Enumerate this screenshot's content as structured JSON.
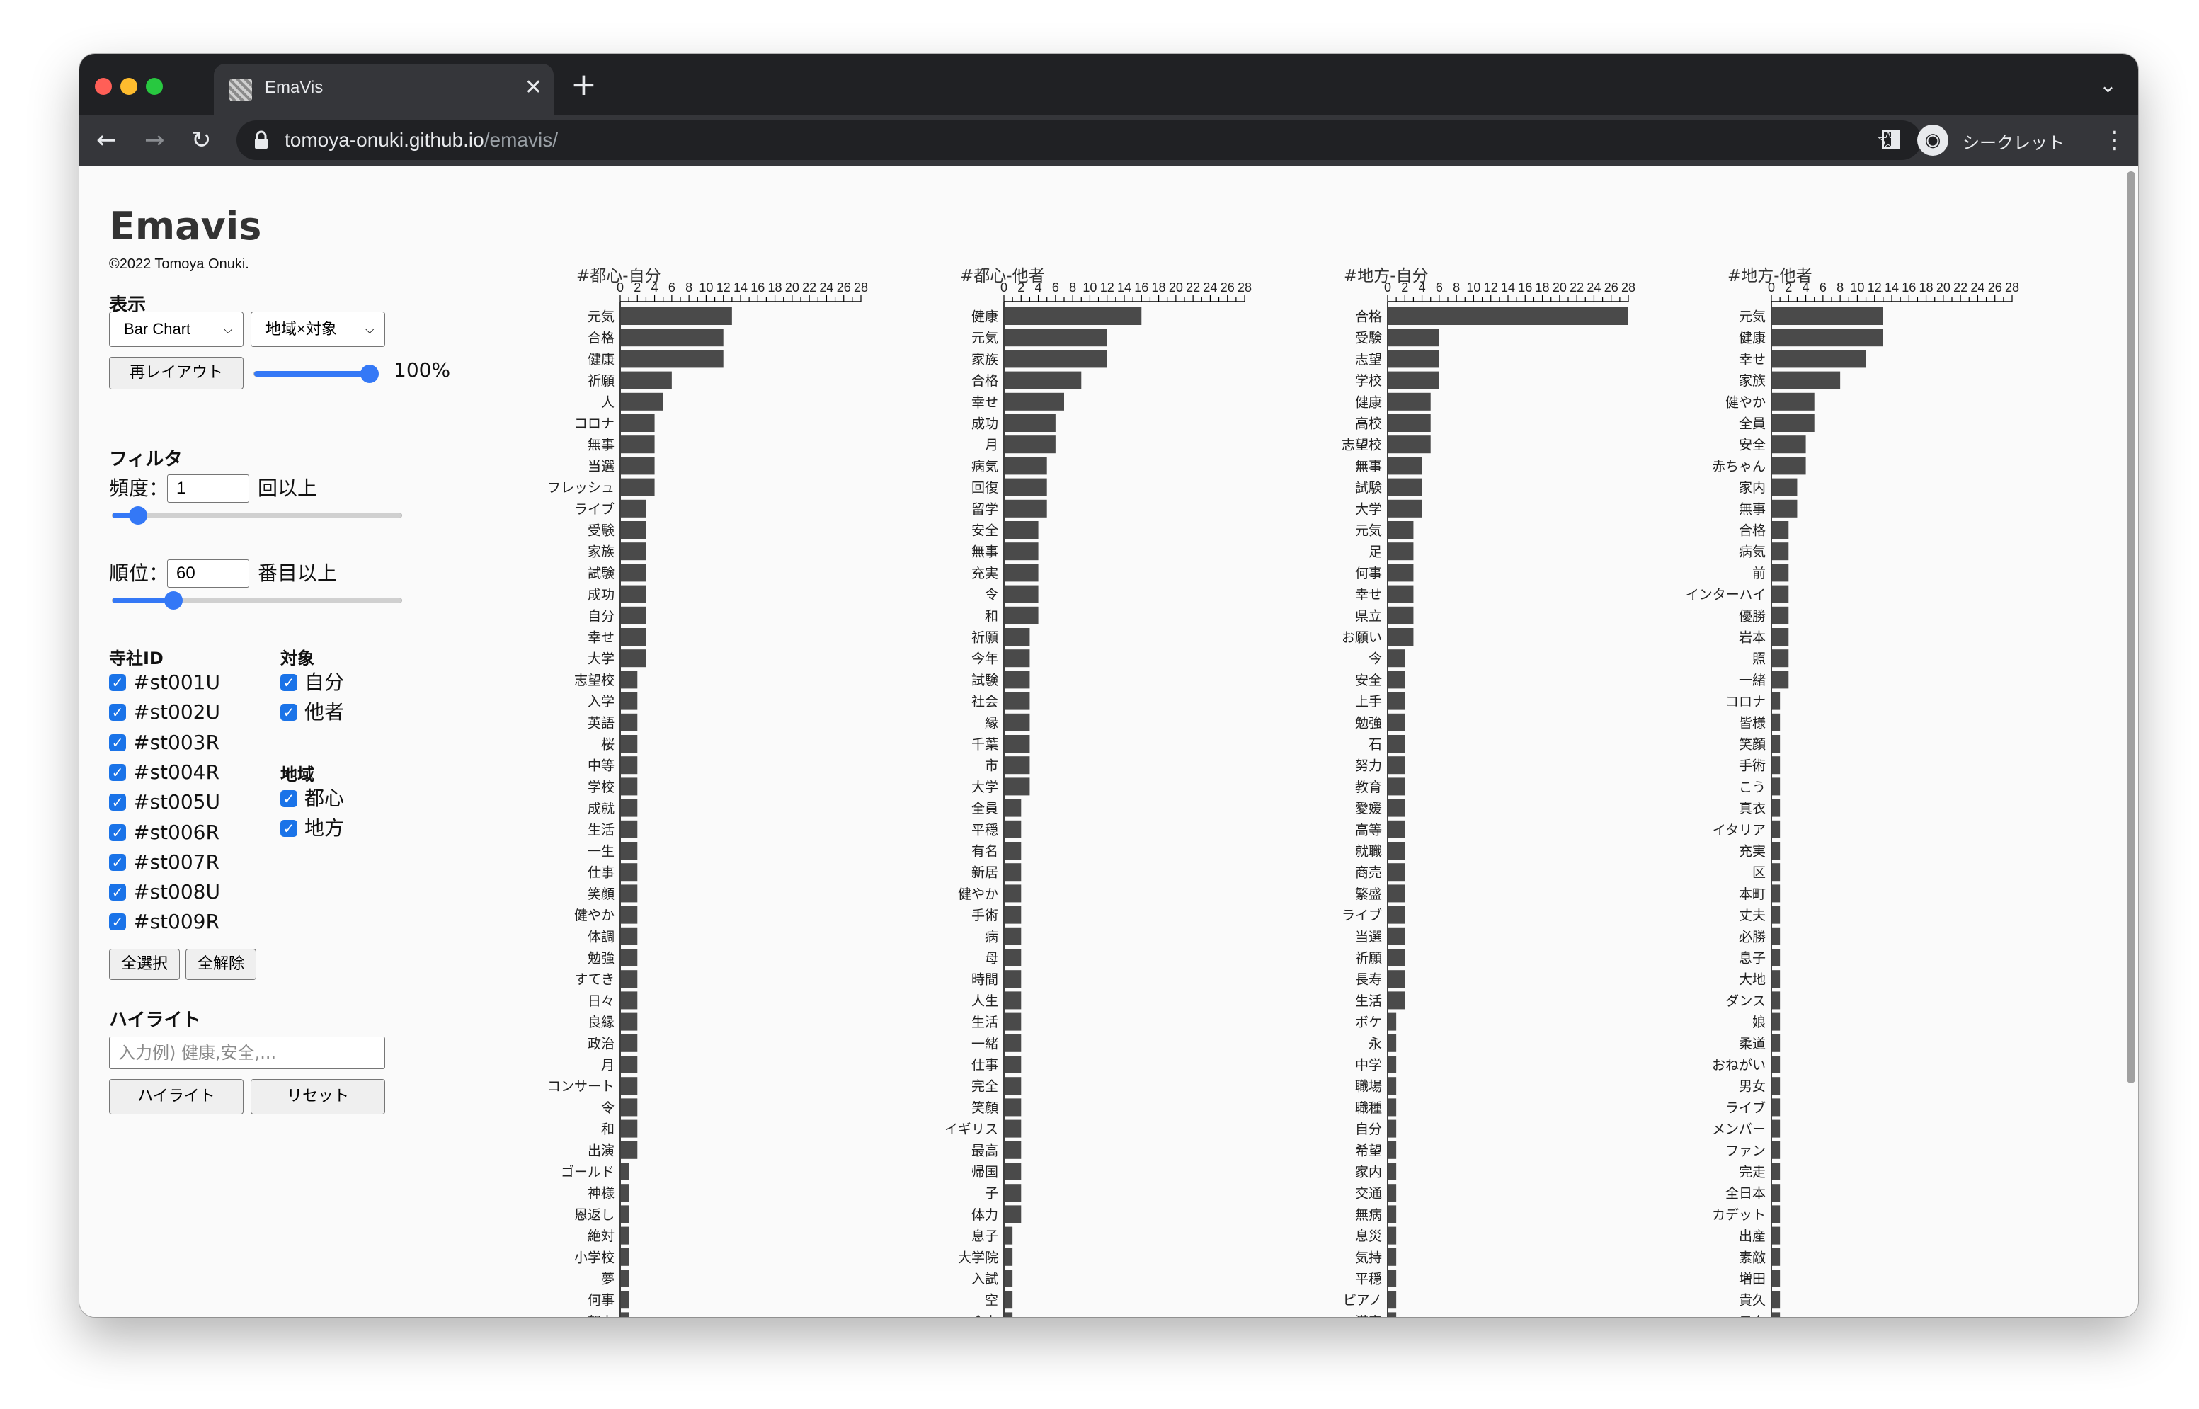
{
  "browser": {
    "tab_title": "EmaVis",
    "url_host": "tomoya-onuki.github.io",
    "url_path": "/emavis/",
    "incognito_label": "シークレット"
  },
  "app": {
    "title": "Emavis",
    "copyright": "©2022 Tomoya Onuki."
  },
  "display": {
    "heading": "表示",
    "chart_type": "Bar Chart",
    "grouping": "地域×対象",
    "relayout_label": "再レイアウト",
    "zoom": 100,
    "zoom_label": "100%"
  },
  "filter": {
    "heading": "フィルタ",
    "freq_label": "頻度：",
    "freq_value": "1",
    "freq_suffix": "回以上",
    "freq_slider": 0.06,
    "rank_label": "順位：",
    "rank_value": "60",
    "rank_suffix": "番目以上",
    "rank_slider": 0.19
  },
  "shrine": {
    "heading": "寺社ID",
    "items": [
      {
        "label": "#st001U",
        "checked": true
      },
      {
        "label": "#st002U",
        "checked": true
      },
      {
        "label": "#st003R",
        "checked": true
      },
      {
        "label": "#st004R",
        "checked": true
      },
      {
        "label": "#st005U",
        "checked": true
      },
      {
        "label": "#st006R",
        "checked": true
      },
      {
        "label": "#st007R",
        "checked": true
      },
      {
        "label": "#st008U",
        "checked": true
      },
      {
        "label": "#st009R",
        "checked": true
      }
    ],
    "select_all": "全選択",
    "deselect_all": "全解除"
  },
  "target": {
    "heading": "対象",
    "items": [
      {
        "label": "自分",
        "checked": true
      },
      {
        "label": "他者",
        "checked": true
      }
    ]
  },
  "region": {
    "heading": "地域",
    "items": [
      {
        "label": "都心",
        "checked": true
      },
      {
        "label": "地方",
        "checked": true
      }
    ]
  },
  "highlight": {
    "heading": "ハイライト",
    "placeholder": "入力例) 健康,安全,...",
    "highlight_button": "ハイライト",
    "reset_button": "リセット"
  },
  "colors": {
    "bar": "#4a4a4a",
    "accent": "#1a73e8"
  },
  "chart_data": [
    {
      "type": "bar",
      "orientation": "horizontal",
      "title": "#都心-自分",
      "xlim": [
        0,
        28
      ],
      "tick_labels": [
        "0",
        "2",
        "4",
        "6",
        "8",
        "10",
        "12",
        "14",
        "16",
        "18",
        "20",
        "22",
        "24",
        "26",
        "28"
      ],
      "categories": [
        "元気",
        "合格",
        "健康",
        "祈願",
        "人",
        "コロナ",
        "無事",
        "当選",
        "フレッシュ",
        "ライブ",
        "受験",
        "家族",
        "試験",
        "成功",
        "自分",
        "幸せ",
        "大学",
        "志望校",
        "入学",
        "英語",
        "桜",
        "中等",
        "学校",
        "成就",
        "生活",
        "一生",
        "仕事",
        "笑顔",
        "健やか",
        "体調",
        "勉強",
        "すてき",
        "日々",
        "良縁",
        "政治",
        "月",
        "コンサート",
        "令",
        "和",
        "出演",
        "ゴールド",
        "神様",
        "恩返し",
        "絶対",
        "小学校",
        "夢",
        "何事",
        "努力"
      ],
      "values": [
        13,
        12,
        12,
        6,
        5,
        4,
        4,
        4,
        4,
        3,
        3,
        3,
        3,
        3,
        3,
        3,
        3,
        2,
        2,
        2,
        2,
        2,
        2,
        2,
        2,
        2,
        2,
        2,
        2,
        2,
        2,
        2,
        2,
        2,
        2,
        2,
        2,
        2,
        2,
        2,
        1,
        1,
        1,
        1,
        1,
        1,
        1,
        1
      ]
    },
    {
      "type": "bar",
      "orientation": "horizontal",
      "title": "#都心-他者",
      "xlim": [
        0,
        28
      ],
      "tick_labels": [
        "0",
        "2",
        "4",
        "6",
        "8",
        "10",
        "12",
        "14",
        "16",
        "18",
        "20",
        "22",
        "24",
        "26",
        "28"
      ],
      "categories": [
        "健康",
        "元気",
        "家族",
        "合格",
        "幸せ",
        "成功",
        "月",
        "病気",
        "回復",
        "留学",
        "安全",
        "無事",
        "充実",
        "令",
        "和",
        "祈願",
        "今年",
        "試験",
        "社会",
        "縁",
        "千葉",
        "市",
        "大学",
        "全員",
        "平穏",
        "有名",
        "新居",
        "健やか",
        "手術",
        "病",
        "母",
        "時間",
        "人生",
        "生活",
        "一緒",
        "仕事",
        "完全",
        "笑顔",
        "イギリス",
        "最高",
        "帰国",
        "子",
        "体力",
        "息子",
        "大学院",
        "入試",
        "空",
        "全力"
      ],
      "values": [
        16,
        12,
        12,
        9,
        7,
        6,
        6,
        5,
        5,
        5,
        4,
        4,
        4,
        4,
        4,
        3,
        3,
        3,
        3,
        3,
        3,
        3,
        3,
        2,
        2,
        2,
        2,
        2,
        2,
        2,
        2,
        2,
        2,
        2,
        2,
        2,
        2,
        2,
        2,
        2,
        2,
        2,
        2,
        1,
        1,
        1,
        1,
        1
      ]
    },
    {
      "type": "bar",
      "orientation": "horizontal",
      "title": "#地方-自分",
      "xlim": [
        0,
        28
      ],
      "tick_labels": [
        "0",
        "2",
        "4",
        "6",
        "8",
        "10",
        "12",
        "14",
        "16",
        "18",
        "20",
        "22",
        "24",
        "26",
        "28"
      ],
      "categories": [
        "合格",
        "受験",
        "志望",
        "学校",
        "健康",
        "高校",
        "志望校",
        "無事",
        "試験",
        "大学",
        "元気",
        "足",
        "何事",
        "幸せ",
        "県立",
        "お願い",
        "今",
        "安全",
        "上手",
        "勉強",
        "石",
        "努力",
        "教育",
        "愛媛",
        "高等",
        "就職",
        "商売",
        "繁盛",
        "ライブ",
        "当選",
        "祈願",
        "長寿",
        "生活",
        "ボケ",
        "永",
        "中学",
        "職場",
        "職種",
        "自分",
        "希望",
        "家内",
        "交通",
        "無病",
        "息災",
        "気持",
        "平穏",
        "ピアノ",
        "漢字"
      ],
      "values": [
        28,
        6,
        6,
        6,
        5,
        5,
        5,
        4,
        4,
        4,
        3,
        3,
        3,
        3,
        3,
        3,
        2,
        2,
        2,
        2,
        2,
        2,
        2,
        2,
        2,
        2,
        2,
        2,
        2,
        2,
        2,
        2,
        2,
        1,
        1,
        1,
        1,
        1,
        1,
        1,
        1,
        1,
        1,
        1,
        1,
        1,
        1,
        1
      ]
    },
    {
      "type": "bar",
      "orientation": "horizontal",
      "title": "#地方-他者",
      "xlim": [
        0,
        28
      ],
      "tick_labels": [
        "0",
        "2",
        "4",
        "6",
        "8",
        "10",
        "12",
        "14",
        "16",
        "18",
        "20",
        "22",
        "24",
        "26",
        "28"
      ],
      "categories": [
        "元気",
        "健康",
        "幸せ",
        "家族",
        "健やか",
        "全員",
        "安全",
        "赤ちゃん",
        "家内",
        "無事",
        "合格",
        "病気",
        "前",
        "インターハイ",
        "優勝",
        "岩本",
        "照",
        "一緒",
        "コロナ",
        "皆様",
        "笑顔",
        "手術",
        "こう",
        "真衣",
        "イタリア",
        "充実",
        "区",
        "本町",
        "丈夫",
        "必勝",
        "息子",
        "大地",
        "ダンス",
        "娘",
        "柔道",
        "おねがい",
        "男女",
        "ライブ",
        "メンバー",
        "ファン",
        "完走",
        "全日本",
        "カデット",
        "出産",
        "素敵",
        "増田",
        "貴久",
        "日向"
      ],
      "values": [
        13,
        13,
        11,
        8,
        5,
        5,
        4,
        4,
        3,
        3,
        2,
        2,
        2,
        2,
        2,
        2,
        2,
        2,
        1,
        1,
        1,
        1,
        1,
        1,
        1,
        1,
        1,
        1,
        1,
        1,
        1,
        1,
        1,
        1,
        1,
        1,
        1,
        1,
        1,
        1,
        1,
        1,
        1,
        1,
        1,
        1,
        1,
        1
      ]
    }
  ]
}
